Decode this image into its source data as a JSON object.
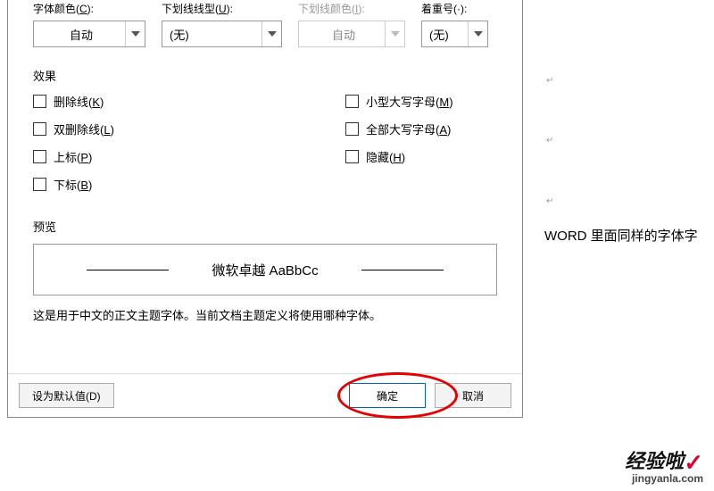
{
  "background": {
    "text_fragment": "WORD 里面同样的字体字",
    "mark": "↵"
  },
  "labels": {
    "font_color": "字体颜色(",
    "font_color_u": "C",
    "font_color_end": "):",
    "underline_style": "下划线线型(",
    "underline_style_u": "U",
    "underline_style_end": "):",
    "underline_color": "下划线颜色(",
    "underline_color_u": "I",
    "underline_color_end": "):",
    "emphasis": "着重号(·):"
  },
  "combos": {
    "font_color": "自动",
    "underline_style": "(无)",
    "underline_color": "自动",
    "emphasis": "(无)"
  },
  "sections": {
    "effects": "效果",
    "preview": "预览"
  },
  "effects_left": [
    {
      "label": "删除线(",
      "u": "K",
      "end": ")"
    },
    {
      "label": "双删除线(",
      "u": "L",
      "end": ")"
    },
    {
      "label": "上标(",
      "u": "P",
      "end": ")"
    },
    {
      "label": "下标(",
      "u": "B",
      "end": ")"
    }
  ],
  "effects_right": [
    {
      "label": "小型大写字母(",
      "u": "M",
      "end": ")"
    },
    {
      "label": "全部大写字母(",
      "u": "A",
      "end": ")"
    },
    {
      "label": "隐藏(",
      "u": "H",
      "end": ")"
    }
  ],
  "preview_text": "微软卓越 AaBbCc",
  "description": "这是用于中文的正文主题字体。当前文档主题定义将使用哪种字体。",
  "buttons": {
    "set_default": "设为默认值(D)",
    "ok": "确定",
    "cancel": "取消"
  },
  "watermark": {
    "line1": "经验啦",
    "check": "✓",
    "line2": "jingyanla.com"
  }
}
